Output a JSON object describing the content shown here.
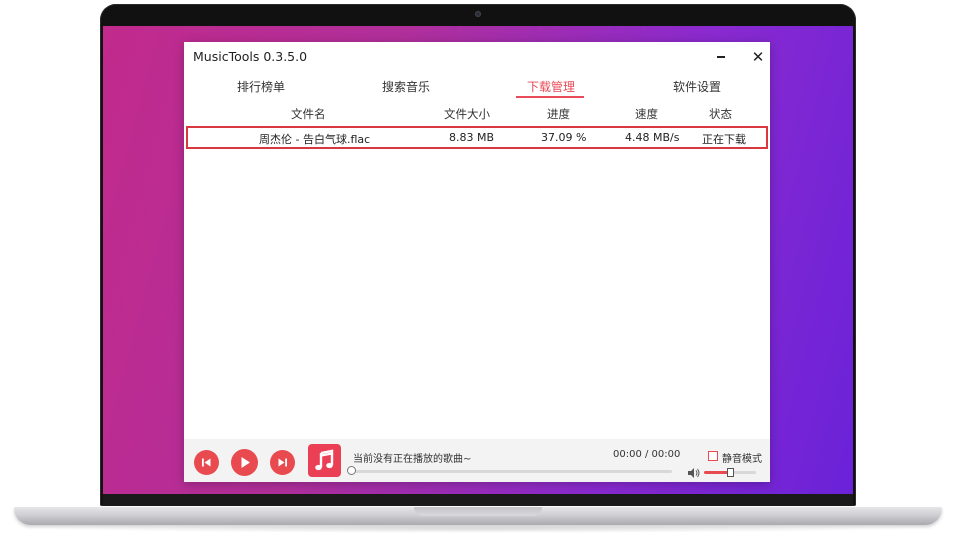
{
  "window": {
    "title": "MusicTools 0.3.5.0",
    "close_glyph": "✕"
  },
  "tabs": [
    {
      "label": "排行榜单",
      "active": false
    },
    {
      "label": "搜索音乐",
      "active": false
    },
    {
      "label": "下载管理",
      "active": true
    },
    {
      "label": "软件设置",
      "active": false
    }
  ],
  "table": {
    "columns": [
      "文件名",
      "文件大小",
      "进度",
      "速度",
      "状态"
    ],
    "rows": [
      {
        "filename": "周杰伦 - 告白气球.flac",
        "size": "8.83 MB",
        "progress": "37.09 %",
        "speed": "4.48 MB/s",
        "status": "正在下载",
        "selected": true
      }
    ]
  },
  "player": {
    "now_playing": "当前没有正在播放的歌曲~",
    "time": "00:00 / 00:00",
    "mute_label": "静音模式",
    "mute_checked": false,
    "seek_fraction": 0,
    "volume_fraction": 0.5,
    "icons": {
      "prev": "skip-previous-icon",
      "play": "play-icon",
      "next": "skip-next-icon",
      "music": "music-note-icon",
      "volume": "volume-icon"
    }
  },
  "colors": {
    "accent": "#e84a4f",
    "active_tab": "#e94b58",
    "row_highlight_border": "#d9383f",
    "wallpaper_start": "#c22a8c",
    "wallpaper_end": "#6a22d8"
  }
}
